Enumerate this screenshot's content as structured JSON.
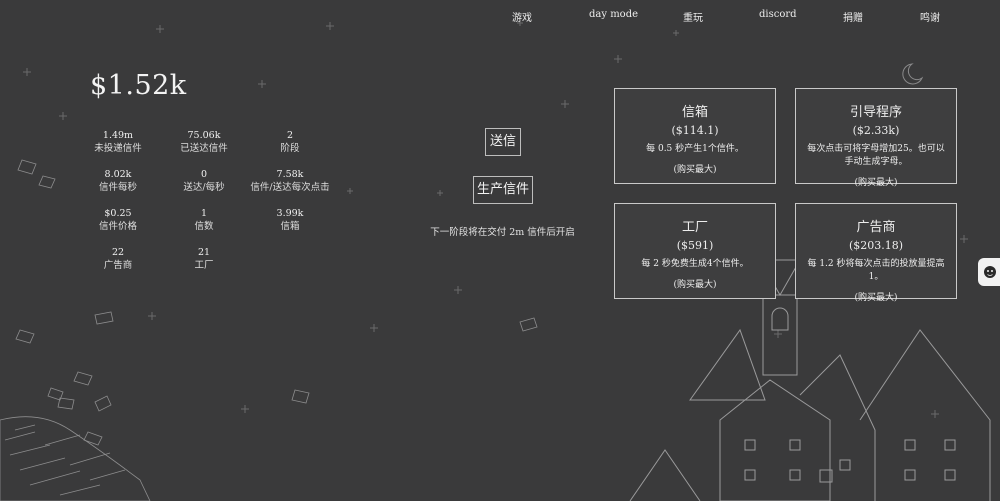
{
  "nav": [
    "游戏",
    "day mode",
    "重玩",
    "discord",
    "捐赠",
    "鸣谢"
  ],
  "money": "$1.52k",
  "stats": [
    {
      "value": "1.49m",
      "label": "未投递信件"
    },
    {
      "value": "75.06k",
      "label": "已送达信件"
    },
    {
      "value": "2",
      "label": "阶段"
    },
    {
      "value": "8.02k",
      "label": "信件每秒"
    },
    {
      "value": "0",
      "label": "送达/每秒"
    },
    {
      "value": "7.58k",
      "label": "信件/送达每次点击"
    },
    {
      "value": "$0.25",
      "label": "信件价格"
    },
    {
      "value": "1",
      "label": "信数"
    },
    {
      "value": "3.99k",
      "label": "信箱"
    },
    {
      "value": "22",
      "label": "广告商"
    },
    {
      "value": "21",
      "label": "工厂"
    }
  ],
  "actions": {
    "send": "送信",
    "produce": "生产信件",
    "unlock_note": "下一阶段将在交付 2m 信件后开启"
  },
  "shop": [
    {
      "title": "信箱",
      "price": "($114.1)",
      "desc": "每 0.5 秒产生1个信件。",
      "buy_max": "(购买最大)"
    },
    {
      "title": "引导程序",
      "price": "($2.33k)",
      "desc": "每次点击可将字母增加25。也可以手动生成字母。",
      "buy_max": "(购买最大)"
    },
    {
      "title": "工厂",
      "price": "($591)",
      "desc": "每 2 秒免费生成4个信件。",
      "buy_max": "(购买最大)"
    },
    {
      "title": "广告商",
      "price": "($203.18)",
      "desc": "每 1.2 秒将每次点击的投放量提高 1。",
      "buy_max": "(购买最大)"
    }
  ],
  "colors": {
    "background": "#3a3a3b",
    "line": "#c9c9c9",
    "text": "#ececec"
  }
}
